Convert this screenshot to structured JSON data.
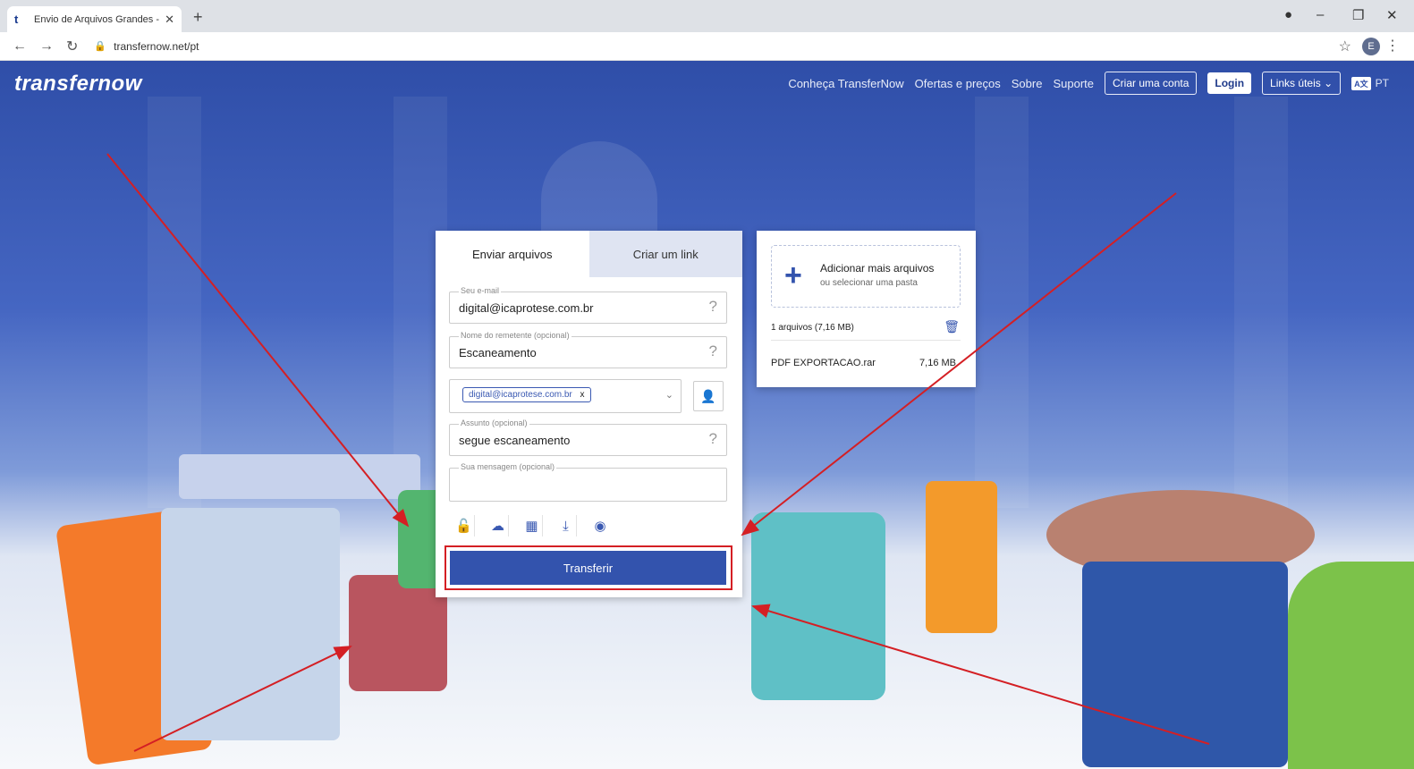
{
  "browser": {
    "tab_title": "Envio de Arquivos Grandes - Com",
    "tab_favicon": "t",
    "new_tab": "+",
    "url": "transfernow.net/pt",
    "profile_initial": "E",
    "icons": {
      "back": "arrow-left-icon",
      "forward": "arrow-right-icon",
      "reload": "reload-icon",
      "lock": "lock-icon",
      "bookmark": "star-icon",
      "menu": "kebab-icon"
    }
  },
  "header": {
    "logo": "transfernow",
    "nav": [
      "Conheça TransferNow",
      "Ofertas e preços",
      "Sobre",
      "Suporte"
    ],
    "create_account": "Criar uma conta",
    "login": "Login",
    "useful_links": "Links úteis",
    "language": "PT"
  },
  "upload": {
    "tabs": [
      "Enviar arquivos",
      "Criar um link"
    ],
    "email_label": "Seu e-mail",
    "email_value": "digital@icaprotese.com.br",
    "sender_label": "Nome do remetente (opcional)",
    "sender_value": "Escaneamento",
    "recipient": "digital@icaprotese.com.br",
    "chip_close": "x",
    "subject_label": "Assunto (opcional)",
    "subject_value": "segue escaneamento",
    "message_label": "Sua mensagem (opcional)",
    "help": "?",
    "tool_icons": [
      "unlock-icon",
      "cloud-icon",
      "calendar-icon",
      "download-icon",
      "eye-icon"
    ],
    "transfer_button": "Transferir"
  },
  "files": {
    "add_title": "Adicionar mais arquivos",
    "add_sub": "ou selecionar uma pasta",
    "count": "1 arquivos (7,16 MB)",
    "file_name": "PDF EXPORTACAO.rar",
    "file_size": "7,16 MB"
  },
  "colors": {
    "accent": "#3353ad",
    "annotation_red": "#d41f24",
    "header_blue": "#2f4ea8"
  }
}
